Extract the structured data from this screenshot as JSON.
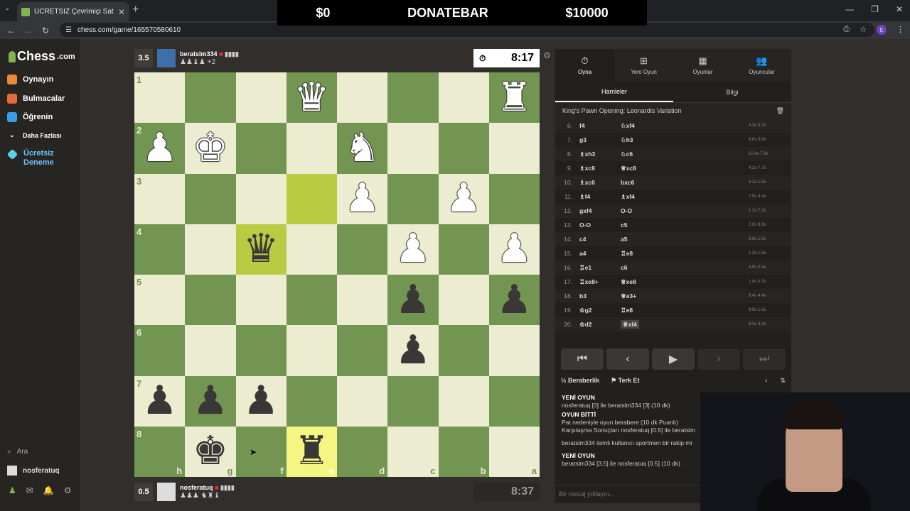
{
  "browser": {
    "tab_title": "ÜCRETSİZ Çevrimiçi Satranç Oy",
    "url": "chess.com/game/165570580610",
    "new_tab": "+",
    "avatar_letter": "E"
  },
  "overlay": {
    "left_amount": "$0",
    "title": "DONATEBAR",
    "right_amount": "$10000"
  },
  "sidebar": {
    "logo_text": "Chess",
    "logo_suffix": ".com",
    "items": [
      {
        "label": "Oynayın",
        "color": "#e88b3a"
      },
      {
        "label": "Bulmacalar",
        "color": "#e86b3a"
      },
      {
        "label": "Öğrenin",
        "color": "#3a9de8"
      },
      {
        "label": "Daha Fazlası",
        "color": "#888888"
      }
    ],
    "trial": "Ücretsiz Deneme",
    "search": "Ara",
    "username": "nosferatuq"
  },
  "top_player": {
    "score": "3.5",
    "name": "beratslm334",
    "captures": "♟♟♝♟ +2",
    "clock": "8:17"
  },
  "bottom_player": {
    "score": "0.5",
    "name": "nosferatuq",
    "captures": "♟♟♟ ♞♜♝",
    "clock": "8:37"
  },
  "board": {
    "files": [
      "h",
      "g",
      "f",
      "e",
      "d",
      "c",
      "b",
      "a"
    ],
    "ranks": [
      "1",
      "2",
      "3",
      "4",
      "5",
      "6",
      "7",
      "8"
    ],
    "rows": [
      [
        "",
        "",
        "",
        "Q",
        "",
        "",
        "",
        "R"
      ],
      [
        "P",
        "K",
        "",
        "",
        "N",
        "",
        "",
        ""
      ],
      [
        "",
        "",
        "",
        "",
        "P",
        "",
        "P",
        ""
      ],
      [
        "",
        "",
        "q",
        "",
        "",
        "P",
        "",
        "P"
      ],
      [
        "",
        "",
        "",
        "",
        "",
        "p",
        "",
        "p"
      ],
      [
        "",
        "",
        "",
        "",
        "",
        "p",
        "",
        ""
      ],
      [
        "p",
        "p",
        "p",
        "",
        "",
        "",
        "",
        ""
      ],
      [
        "",
        "k",
        "",
        "r",
        "",
        "",
        "",
        ""
      ]
    ]
  },
  "panel": {
    "tabs": [
      {
        "label": "Oyna",
        "icon": "⏱"
      },
      {
        "label": "Yeni Oyun",
        "icon": "⊞"
      },
      {
        "label": "Oyunlar",
        "icon": "▦"
      },
      {
        "label": "Oyuncular",
        "icon": "👥"
      }
    ],
    "subtabs": [
      "Hamleler",
      "Bilgi"
    ],
    "opening": "King's Pawn Opening: Leonardis Variation",
    "moves": [
      {
        "n": "6.",
        "w": "f4",
        "b": "♘xf4",
        "t": "4.3s 3.7s"
      },
      {
        "n": "7.",
        "w": "g3",
        "b": "♘h3",
        "t": "6.8s 5.8s"
      },
      {
        "n": "8.",
        "w": "♗xh3",
        "b": "♘c6",
        "t": "10.4s 7.8s"
      },
      {
        "n": "9.",
        "w": "♗xc8",
        "b": "♕xc8",
        "t": "4.2s 7.7s"
      },
      {
        "n": "10.",
        "w": "♗xc6",
        "b": "bxc6",
        "t": "3.2s 1.5s"
      },
      {
        "n": "11.",
        "w": "♗f4",
        "b": "♗xf4",
        "t": "7.5s 4.4s"
      },
      {
        "n": "12.",
        "w": "gxf4",
        "b": "O-O",
        "t": "1.2s 7.2s"
      },
      {
        "n": "13.",
        "w": "O-O",
        "b": "c5",
        "t": "2.6s 8.8s"
      },
      {
        "n": "14.",
        "w": "c4",
        "b": "a5",
        "t": "2.6s 1.5s"
      },
      {
        "n": "15.",
        "w": "a4",
        "b": "♖e8",
        "t": "1.3s 1.8s"
      },
      {
        "n": "16.",
        "w": "♖e1",
        "b": "c6",
        "t": "4.9s 0.4s"
      },
      {
        "n": "17.",
        "w": "♖xe8+",
        "b": "♕xe8",
        "t": "1.4s 0.7s"
      },
      {
        "n": "18.",
        "w": "b3",
        "b": "♕e3+",
        "t": "6.4s 4.4s"
      },
      {
        "n": "19.",
        "w": "♔g2",
        "b": "♖e8",
        "t": "9.9s 1.6s"
      },
      {
        "n": "20.",
        "w": "♔d2",
        "b": "♕xf4",
        "t": "8.3s 4.3s"
      }
    ],
    "controls": [
      "⏮",
      "‹",
      "▶",
      "›",
      "⏭"
    ],
    "draw": "Beraberlik",
    "resign": "Terk Et",
    "chat": {
      "new_game_1": "YENİ OYUN",
      "new_game_1_line": "nosferatuq [0] ile beratslm334 [3] (10 dk)",
      "game_over": "OYUN BİTTİ",
      "game_over_line": "Pat nedeniyle oyun berabere (10 dk Puanlı)",
      "results_line": "Karşılaşma Sonuçları nosferatuq [0.5] ile beratslm",
      "sportsman_line": "beratslm334 isimli kullanıcı sportmen bir rakip mi",
      "new_game_2": "YENİ OYUN",
      "new_game_2_line": "beratslm334 [3.5] ile nosferatuq [0.5] (10 dk)"
    },
    "message_placeholder": "Bir mesaj yollayın..."
  }
}
